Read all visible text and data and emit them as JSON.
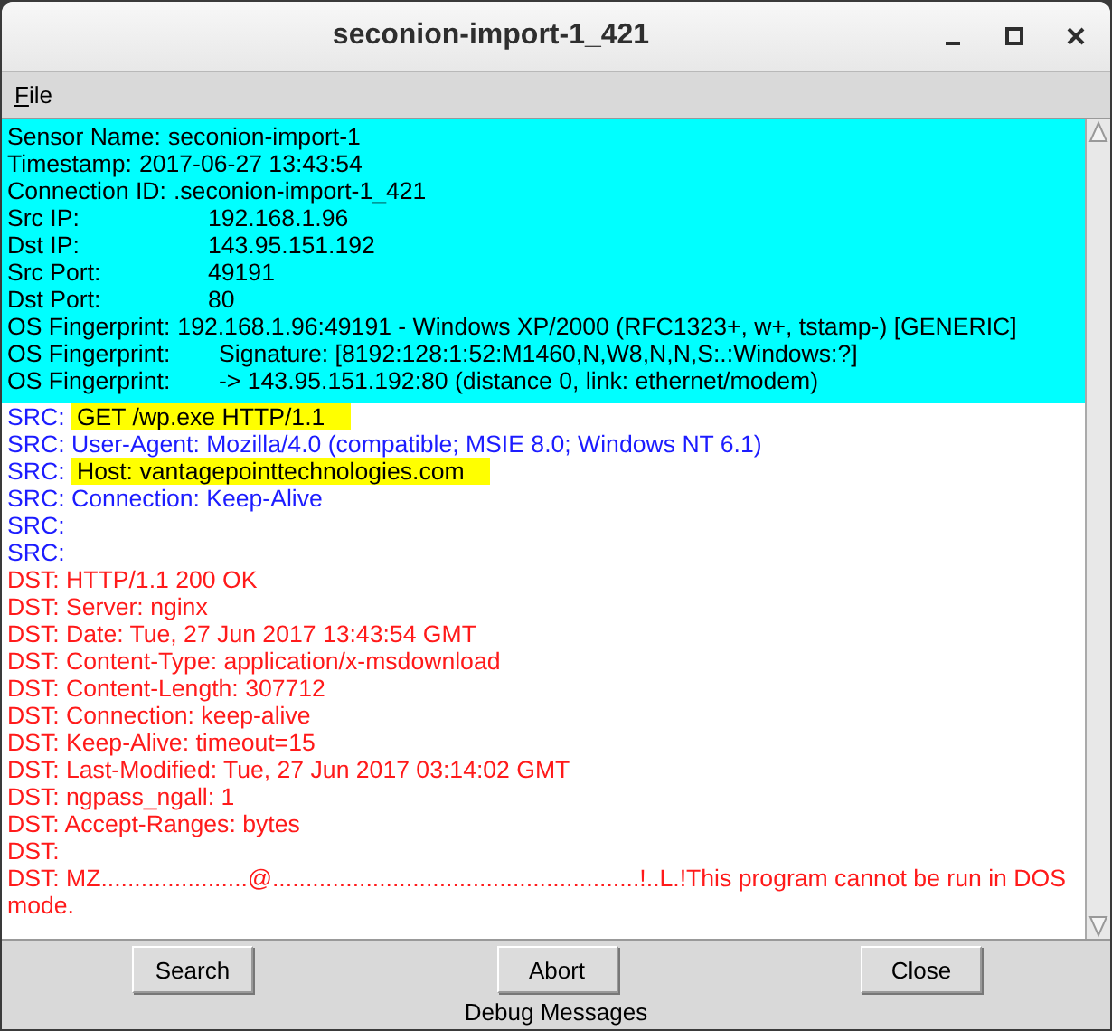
{
  "window": {
    "title": "seconion-import-1_421"
  },
  "menu": [
    {
      "mnemonic": "F",
      "rest": "ile"
    }
  ],
  "header": [
    {
      "kind": "inline",
      "label": "Sensor Name:",
      "value": "seconion-import-1"
    },
    {
      "kind": "inline",
      "label": "Timestamp:",
      "value": "2017-06-27 13:43:54"
    },
    {
      "kind": "inline",
      "label": "Connection ID:",
      "value": ".seconion-import-1_421"
    },
    {
      "kind": "tabbed",
      "label": "Src IP:",
      "value": "192.168.1.96"
    },
    {
      "kind": "tabbed",
      "label": "Dst IP:",
      "value": "143.95.151.192"
    },
    {
      "kind": "tabbed",
      "label": "Src Port:",
      "value": "49191"
    },
    {
      "kind": "tabbed",
      "label": "Dst Port:",
      "value": "80"
    },
    {
      "kind": "inline",
      "label": "OS Fingerprint:",
      "value": "192.168.1.96:49191 - Windows XP/2000 (RFC1323+, w+, tstamp-) [GENERIC]"
    },
    {
      "kind": "indented",
      "label": "OS Fingerprint:",
      "value": "Signature: [8192:128:1:52:M1460,N,W8,N,N,S:.:Windows:?]"
    },
    {
      "kind": "indented",
      "label": "OS Fingerprint:",
      "value": "-> 143.95.151.192:80 (distance 0, link: ethernet/modem)"
    }
  ],
  "lines": [
    {
      "kind": "src",
      "prefix": "SRC:",
      "text": "GET /wp.exe HTTP/1.1",
      "highlighted": true
    },
    {
      "kind": "src",
      "prefix": "SRC:",
      "text": "User-Agent: Mozilla/4.0 (compatible; MSIE 8.0; Windows NT 6.1)",
      "highlighted": false
    },
    {
      "kind": "src",
      "prefix": "SRC:",
      "text": "Host: vantagepointtechnologies.com",
      "highlighted": true
    },
    {
      "kind": "src",
      "prefix": "SRC:",
      "text": "Connection: Keep-Alive",
      "highlighted": false
    },
    {
      "kind": "src",
      "prefix": "SRC:"
    },
    {
      "kind": "src",
      "prefix": "SRC:"
    },
    {
      "kind": "dst",
      "prefix": "DST:",
      "text": "HTTP/1.1 200 OK",
      "highlighted": false
    },
    {
      "kind": "dst",
      "prefix": "DST:",
      "text": "Server: nginx",
      "highlighted": false
    },
    {
      "kind": "dst",
      "prefix": "DST:",
      "text": "Date: Tue, 27 Jun 2017 13:43:54 GMT",
      "highlighted": false
    },
    {
      "kind": "dst",
      "prefix": "DST:",
      "text": "Content-Type: application/x-msdownload",
      "highlighted": false
    },
    {
      "kind": "dst",
      "prefix": "DST:",
      "text": "Content-Length: 307712",
      "highlighted": false
    },
    {
      "kind": "dst",
      "prefix": "DST:",
      "text": "Connection: keep-alive",
      "highlighted": false
    },
    {
      "kind": "dst",
      "prefix": "DST:",
      "text": "Keep-Alive: timeout=15",
      "highlighted": false
    },
    {
      "kind": "dst",
      "prefix": "DST:",
      "text": "Last-Modified: Tue, 27 Jun 2017 03:14:02 GMT",
      "highlighted": false
    },
    {
      "kind": "dst",
      "prefix": "DST:",
      "text": "ngpass_ngall: 1",
      "highlighted": false
    },
    {
      "kind": "dst",
      "prefix": "DST:",
      "text": "Accept-Ranges: bytes",
      "highlighted": false
    },
    {
      "kind": "dst",
      "prefix": "DST:"
    },
    {
      "kind": "dst",
      "prefix": "DST:",
      "text": "MZ......................@.......................................................!..L.!This program cannot be run in DOS mode.",
      "highlighted": false
    }
  ],
  "buttons": [
    {
      "label": "Search"
    },
    {
      "label": "Abort"
    },
    {
      "label": "Close"
    }
  ],
  "status": "Debug Messages"
}
